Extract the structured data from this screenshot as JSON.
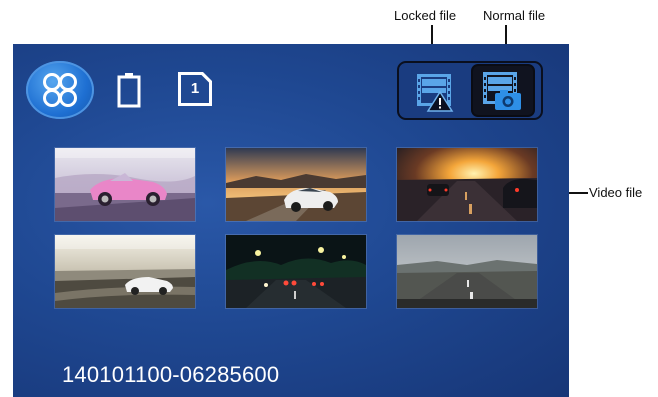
{
  "callouts": {
    "locked_file": "Locked file",
    "normal_file": "Normal file",
    "video_file": "Video file"
  },
  "toolbar": {
    "menu_icon": "four-circles-grid-icon",
    "battery_icon": "battery-icon",
    "sd_card_label": "1",
    "locked_filter_icon": "film-warning-icon",
    "normal_filter_icon": "film-camera-icon"
  },
  "thumbnails": [
    {
      "subject": "pink convertible car"
    },
    {
      "subject": "white sedan at sunset"
    },
    {
      "subject": "cars on road at sunset"
    },
    {
      "subject": "white car on coastal road"
    },
    {
      "subject": "night traffic street"
    },
    {
      "subject": "highway dashcam view"
    }
  ],
  "status": {
    "filename": "140101100-06285600"
  },
  "colors": {
    "screen_background": "#1f4892",
    "menu_button": "#1e6fd2",
    "selected_segment": "#10131f",
    "text": "#ffffff"
  }
}
